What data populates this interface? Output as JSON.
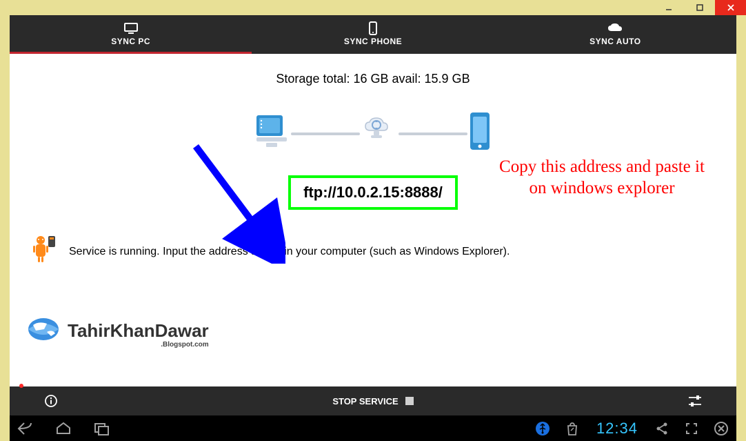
{
  "titlebar": {
    "min": "—",
    "max": "❐",
    "close": "✕"
  },
  "tabs": {
    "pc": "SYNC PC",
    "phone": "SYNC PHONE",
    "auto": "SYNC AUTO"
  },
  "storage_line": "Storage total: 16 GB    avail: 15.9 GB",
  "ftp_address": "ftp://10.0.2.15:8888/",
  "annotation": "Copy this address and paste it on windows explorer",
  "status": "Service is running. Input the address above in your computer (such as Windows Explorer).",
  "brand": {
    "name": "TahirKhanDawar",
    "sub": ".Blogspot.com"
  },
  "action_bar": {
    "stop": "STOP SERVICE"
  },
  "navbar": {
    "clock": "12:34"
  }
}
